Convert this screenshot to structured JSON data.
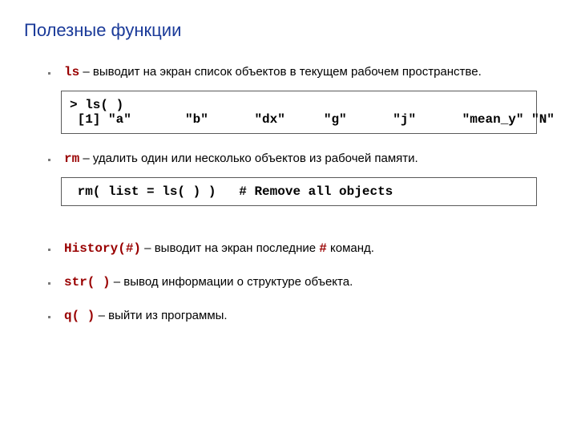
{
  "title": "Полезные функции",
  "items": {
    "ls": {
      "cmd": "ls",
      "sep": " – ",
      "txt": "выводит на экран список объектов в текущем рабочем пространстве."
    },
    "rm": {
      "cmd": "rm",
      "sep": " – ",
      "txt": "удалить один или несколько объектов из рабочей памяти."
    },
    "hist": {
      "cmd": "History(#)",
      "sep": "  –  ",
      "txt1": "выводит на экран последние ",
      "hash": "#",
      "txt2": " команд."
    },
    "str": {
      "cmd": "str( )",
      "sep": "  –  ",
      "txt": " вывод информации о структуре объекта."
    },
    "q": {
      "cmd": "q( )",
      "sep": "  –  ",
      "txt": " выйти из программы."
    }
  },
  "code": {
    "ls1": "> ls( )",
    "ls2": " [1] \"a\"       \"b\"      \"dx\"     \"g\"      \"j\"      \"mean_y\" \"N\"",
    "rm": " rm( list = ls( ) )   # Remove all objects"
  },
  "colors": {
    "cmdRed": "#990000"
  }
}
